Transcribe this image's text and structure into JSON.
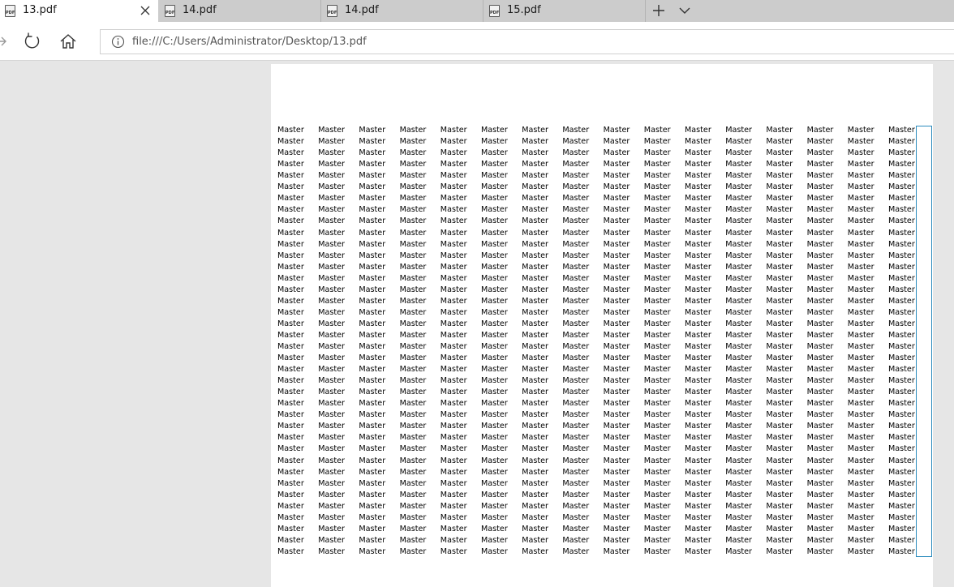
{
  "tabs": [
    {
      "label": "13.pdf",
      "icon": "pdf-file-icon",
      "active": true
    },
    {
      "label": "14.pdf",
      "icon": "pdf-file-icon",
      "active": false
    },
    {
      "label": "14.pdf",
      "icon": "pdf-file-icon",
      "active": false
    },
    {
      "label": "15.pdf",
      "icon": "pdf-file-icon",
      "active": false
    }
  ],
  "pdf_icon_text": "PDF",
  "address": {
    "url": "file:///C:/Users/Administrator/Desktop/13.pdf"
  },
  "document": {
    "cell_text": "Master",
    "rows": 38,
    "columns": 16
  },
  "colors": {
    "tabbar": "#cccccc",
    "active_tab": "#ffffff",
    "viewer_bg": "#e6e6e6",
    "selection": "#2b8bbd"
  }
}
